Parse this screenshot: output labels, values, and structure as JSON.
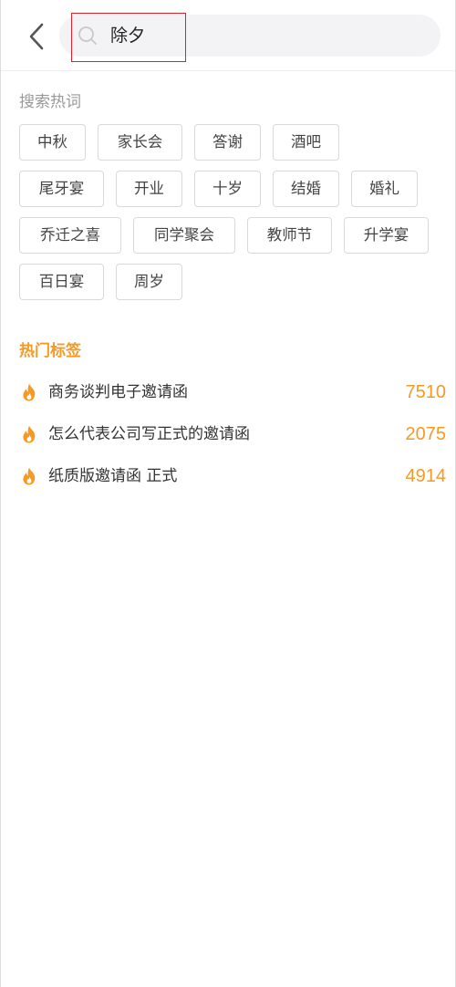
{
  "search": {
    "value": "除夕",
    "placeholder": ""
  },
  "hot_words": {
    "title": "搜索热词",
    "rows": [
      [
        "中秋",
        "家长会",
        "答谢",
        "酒吧"
      ],
      [
        "尾牙宴",
        "开业",
        "十岁",
        "结婚",
        "婚礼"
      ],
      [
        "乔迁之喜",
        "同学聚会",
        "教师节",
        "升学宴"
      ],
      [
        "百日宴",
        "周岁"
      ]
    ]
  },
  "hot_tags": {
    "title": "热门标签",
    "items": [
      {
        "text": "商务谈判电子邀请函",
        "count": "7510"
      },
      {
        "text": "怎么代表公司写正式的邀请函",
        "count": "2075"
      },
      {
        "text": "纸质版邀请函 正式",
        "count": "4914"
      }
    ]
  },
  "colors": {
    "accent": "#f59a23",
    "highlight_border": "#e0212a",
    "muted_text": "#999999"
  },
  "icons": {
    "back": "chevron-left-icon",
    "search": "search-icon",
    "hot": "fire-icon"
  }
}
